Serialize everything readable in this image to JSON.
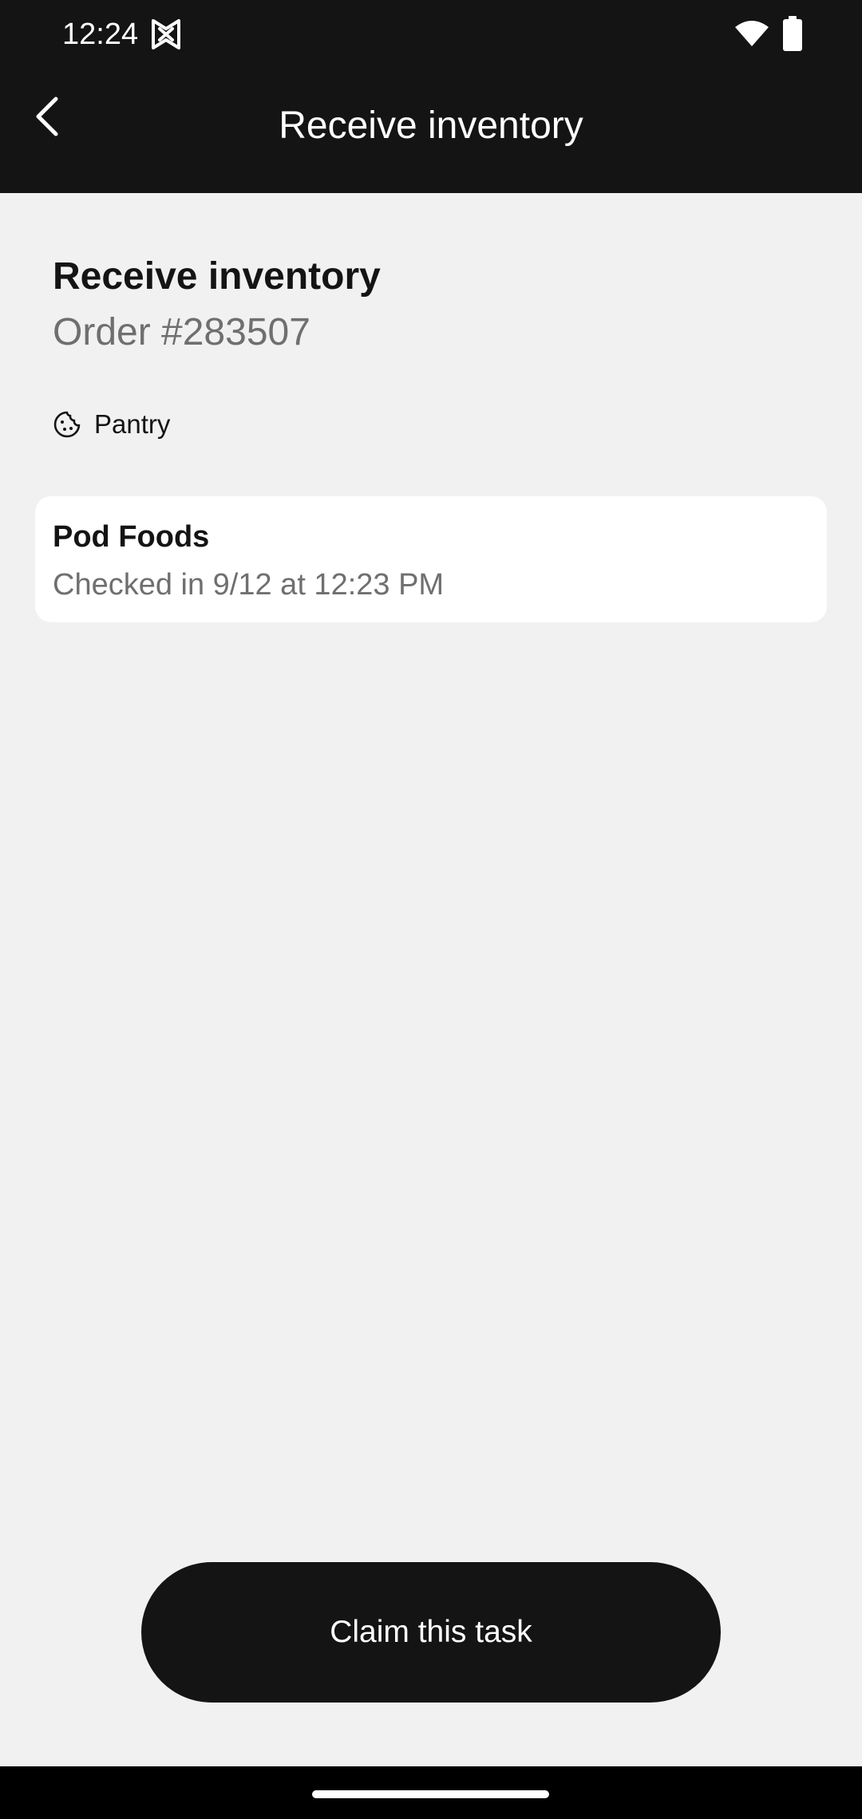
{
  "status_bar": {
    "time": "12:24",
    "icons": [
      "app-logo-icon",
      "wifi-icon",
      "battery-icon"
    ]
  },
  "app_bar": {
    "title": "Receive inventory",
    "back_icon": "chevron-left-icon"
  },
  "task": {
    "title": "Receive inventory",
    "order_number": "Order #283507",
    "category": {
      "icon": "cookie-icon",
      "label": "Pantry"
    }
  },
  "vendor_card": {
    "name": "Pod Foods",
    "checked_in": "Checked in 9/12 at 12:23 PM"
  },
  "actions": {
    "claim_label": "Claim this task"
  },
  "colors": {
    "bar_background": "#141414",
    "page_background": "#f1f1f1",
    "card_background": "#ffffff",
    "primary_text": "#141414",
    "secondary_text": "#6f6f6f",
    "button_background": "#141414",
    "button_text": "#ffffff"
  }
}
